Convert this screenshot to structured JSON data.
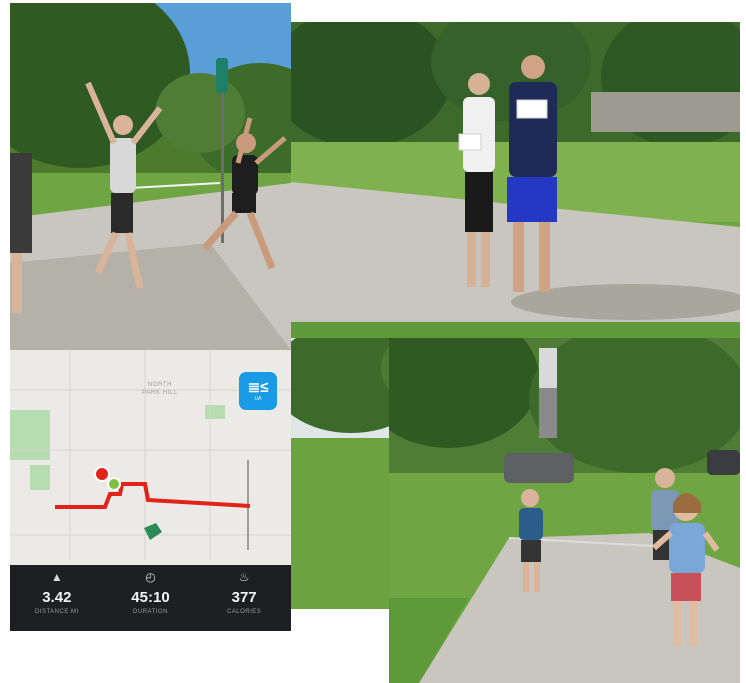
{
  "app": {
    "brand_mark": "≣≤",
    "brand_sub": "UA",
    "map_labels": [
      "NORTH",
      "PARK HILL"
    ],
    "stats": [
      {
        "icon": "shoe-icon",
        "glyph": "▲",
        "value": "3.42",
        "label": "DISTANCE MI"
      },
      {
        "icon": "stopwatch-icon",
        "glyph": "◴",
        "value": "45:10",
        "label": "DURATION"
      },
      {
        "icon": "flame-icon",
        "glyph": "♨",
        "value": "377",
        "label": "CALORIES"
      }
    ]
  },
  "colors": {
    "grass": "#6fa542",
    "sky": "#5a9ed8",
    "path": "#c9c6bf",
    "route": "#e2231a",
    "app_blue": "#1a9be6"
  }
}
